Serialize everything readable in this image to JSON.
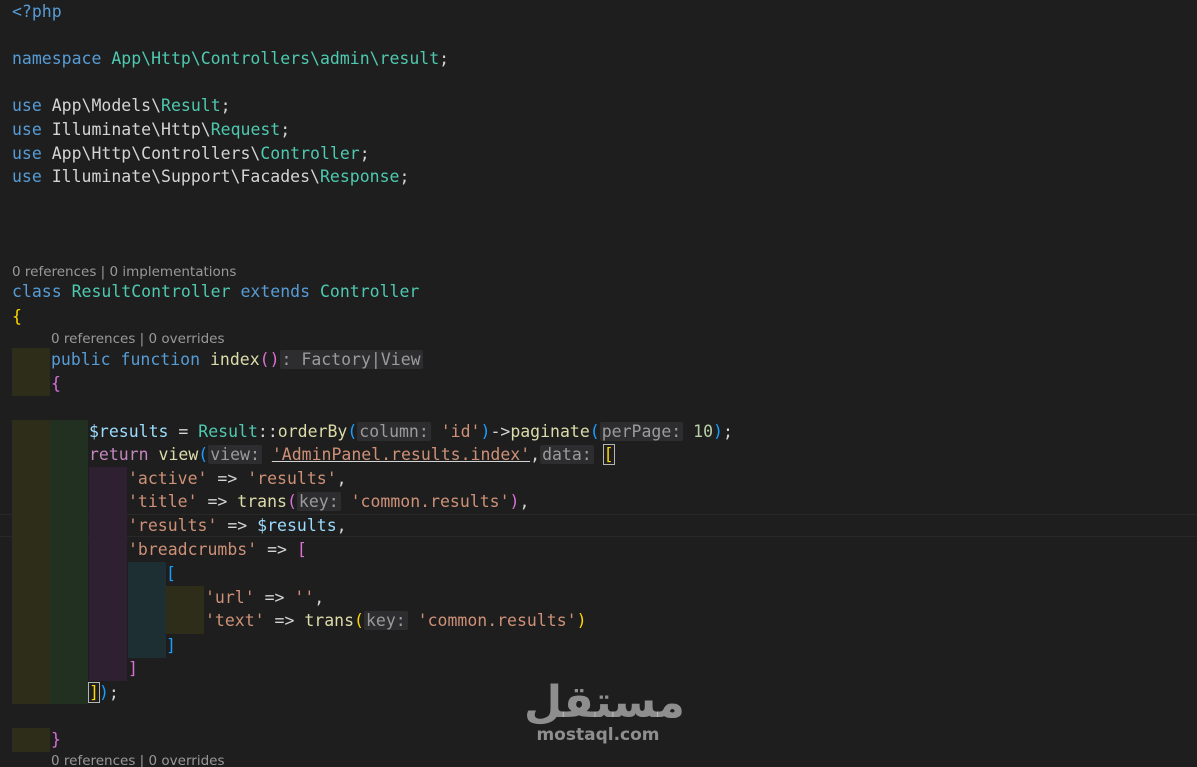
{
  "code": {
    "php_open": "<?php",
    "namespace_kw": "namespace",
    "namespace_path": "App\\Http\\Controllers\\admin\\result",
    "use_kw": "use",
    "use1_ns": "App\\Models\\",
    "use1_cls": "Result",
    "use2_ns": "Illuminate\\Http\\",
    "use2_cls": "Request",
    "use3_ns": "App\\Http\\Controllers\\",
    "use3_cls": "Controller",
    "use4_ns": "Illuminate\\Support\\Facades\\",
    "use4_cls": "Response",
    "semi": ";",
    "class_kw": "class",
    "class_name": "ResultController",
    "extends_kw": "extends",
    "parent_cls": "Controller",
    "open_brace": "{",
    "close_brace": "}",
    "public_kw": "public",
    "function_kw": "function",
    "method_name": "index",
    "parens": "()",
    "return_hint": ": Factory|View",
    "results_var": "$results",
    "assign": " = ",
    "result_cls": "Result",
    "scope": "::",
    "orderby_fn": "orderBy",
    "lparen": "(",
    "rparen": ")",
    "hint_column": "column:",
    "str_id": "'id'",
    "arrow": "->",
    "paginate_fn": "paginate",
    "hint_perpage": "perPage:",
    "num_10": "10",
    "close_stmt": ");",
    "return_kw": "return",
    "view_fn": "view",
    "hint_view": "view:",
    "str_view": "'AdminPanel.results.index'",
    "comma": ",",
    "hint_data": "data:",
    "lbracket": "[",
    "rbracket": "]",
    "str_active": "'active'",
    "fat_arrow": " => ",
    "str_results": "'results'",
    "str_title": "'title'",
    "trans_fn": "trans",
    "hint_key": "key:",
    "str_common_results": "'common.results'",
    "str_results_key": "'results'",
    "str_breadcrumbs": "'breadcrumbs'",
    "str_url": "'url'",
    "str_empty": "''",
    "str_text": "'text'"
  },
  "lens": {
    "class_refs": "0 references",
    "class_sep": " | ",
    "class_impls": "0 implementations",
    "method_refs": "0 references",
    "method_sep": " | ",
    "method_overrides": "0 overrides",
    "bottom_refs": "0 references",
    "bottom_sep": " | ",
    "bottom_overrides": "0 overrides"
  },
  "watermark": {
    "arabic": "مستقل",
    "url": "mostaql.com"
  }
}
